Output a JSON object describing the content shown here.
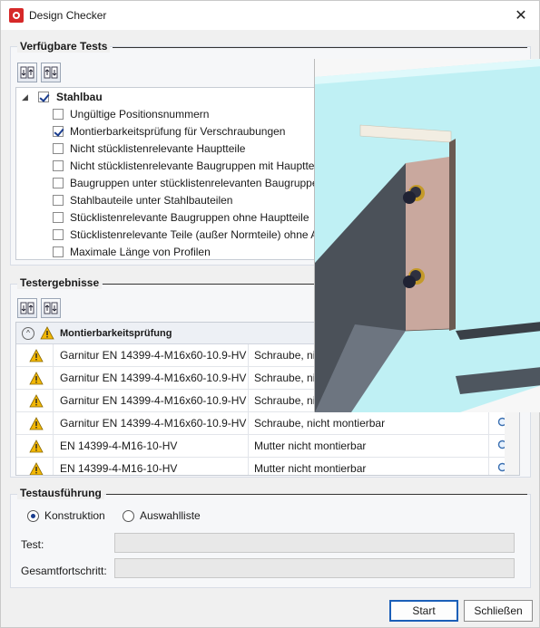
{
  "window": {
    "title": "Design Checker",
    "close_glyph": "✕"
  },
  "available_tests": {
    "title": "Verfügbare Tests",
    "toolbar": [
      "expand-all-icon",
      "collapse-all-icon"
    ],
    "root": {
      "label": "Stahlbau",
      "checked": true,
      "expander": "◢"
    },
    "items": [
      {
        "label": "Ungültige Positionsnummern",
        "checked": false
      },
      {
        "label": "Montierbarkeitsprüfung für Verschraubungen",
        "checked": true
      },
      {
        "label": "Nicht stücklistenrelevante Hauptteile",
        "checked": false
      },
      {
        "label": "Nicht stücklistenrelevante Baugruppen mit Hauptteile",
        "checked": false
      },
      {
        "label": "Baugruppen unter stücklistenrelevanten Baugruppe",
        "checked": false
      },
      {
        "label": "Stahlbauteile unter Stahlbauteilen",
        "checked": false
      },
      {
        "label": "Stücklistenrelevante Baugruppen ohne Hauptteile",
        "checked": false
      },
      {
        "label": "Stücklistenrelevante Teile (außer Normteile) ohne A",
        "checked": false
      },
      {
        "label": "Maximale Länge von Profilen",
        "checked": false
      }
    ]
  },
  "results": {
    "title": "Testergebnisse",
    "group_label": "Montierbarkeitsprüfung",
    "collapse_glyph": "^",
    "rows": [
      {
        "name": "Garnitur EN 14399-4-M16x60-10.9-HV",
        "status": "Schraube, nic"
      },
      {
        "name": "Garnitur EN 14399-4-M16x60-10.9-HV",
        "status": "Schraube, nic"
      },
      {
        "name": "Garnitur EN 14399-4-M16x60-10.9-HV",
        "status": "Schraube, nic"
      },
      {
        "name": "Garnitur EN 14399-4-M16x60-10.9-HV",
        "status": "Schraube, nicht montierbar"
      },
      {
        "name": "EN 14399-4-M16-10-HV",
        "status": "Mutter nicht montierbar"
      },
      {
        "name": "EN 14399-4-M16-10-HV",
        "status": "Mutter nicht montierbar"
      }
    ]
  },
  "execution": {
    "title": "Testausführung",
    "radio_construction": "Konstruktion",
    "radio_selection": "Auswahlliste",
    "selected": "Konstruktion",
    "test_label": "Test:",
    "test_value": "",
    "progress_label": "Gesamtfortschritt:",
    "progress_value": ""
  },
  "buttons": {
    "start": "Start",
    "close": "Schließen"
  },
  "colors": {
    "accent": "#1b5fb8",
    "warning": "#f2b705",
    "sky": "#bff0f4"
  }
}
